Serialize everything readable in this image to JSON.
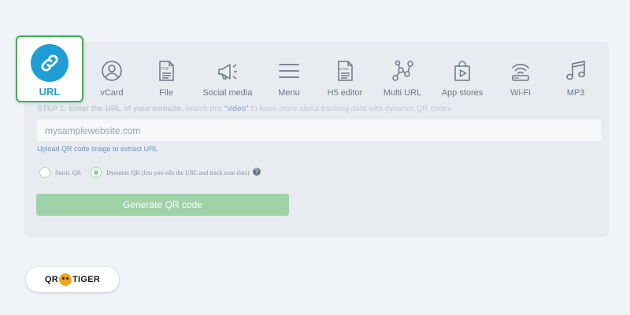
{
  "tabs": [
    {
      "label": "URL",
      "icon": "link-icon",
      "active": true
    },
    {
      "label": "vCard",
      "icon": "user-circle-icon"
    },
    {
      "label": "File",
      "icon": "pdf-file-icon"
    },
    {
      "label": "Social media",
      "icon": "megaphone-icon"
    },
    {
      "label": "Menu",
      "icon": "menu-icon"
    },
    {
      "label": "H5 editor",
      "icon": "html-file-icon"
    },
    {
      "label": "Multi URL",
      "icon": "network-icon"
    },
    {
      "label": "App stores",
      "icon": "shopping-bag-icon"
    },
    {
      "label": "Wi-Fi",
      "icon": "wifi-router-icon"
    },
    {
      "label": "MP3",
      "icon": "music-note-icon"
    }
  ],
  "step": {
    "prefix": "STEP 1: Enter the URL of your website.",
    "watch": "Watch this",
    "video_link": "\"video\"",
    "suffix": "to learn more about tracking data with dynamic QR codes"
  },
  "url_input": {
    "placeholder": "mysamplewebsite.com",
    "value": ""
  },
  "upload_link": "Upload QR code image to extract URL",
  "qr_type": {
    "static_label": "Static QR",
    "dynamic_label": "Dynamic QR (lets you edit the URL and track scan data)",
    "selected": "dynamic",
    "help_symbol": "?"
  },
  "generate_button": "Generate QR code",
  "brand": {
    "left": "QR",
    "right": "TIGER"
  },
  "colors": {
    "accent_blue": "#1f9ed6",
    "active_border": "#3cb54a",
    "button_green": "#9ed3a8",
    "brand_orange": "#f2a41c"
  }
}
